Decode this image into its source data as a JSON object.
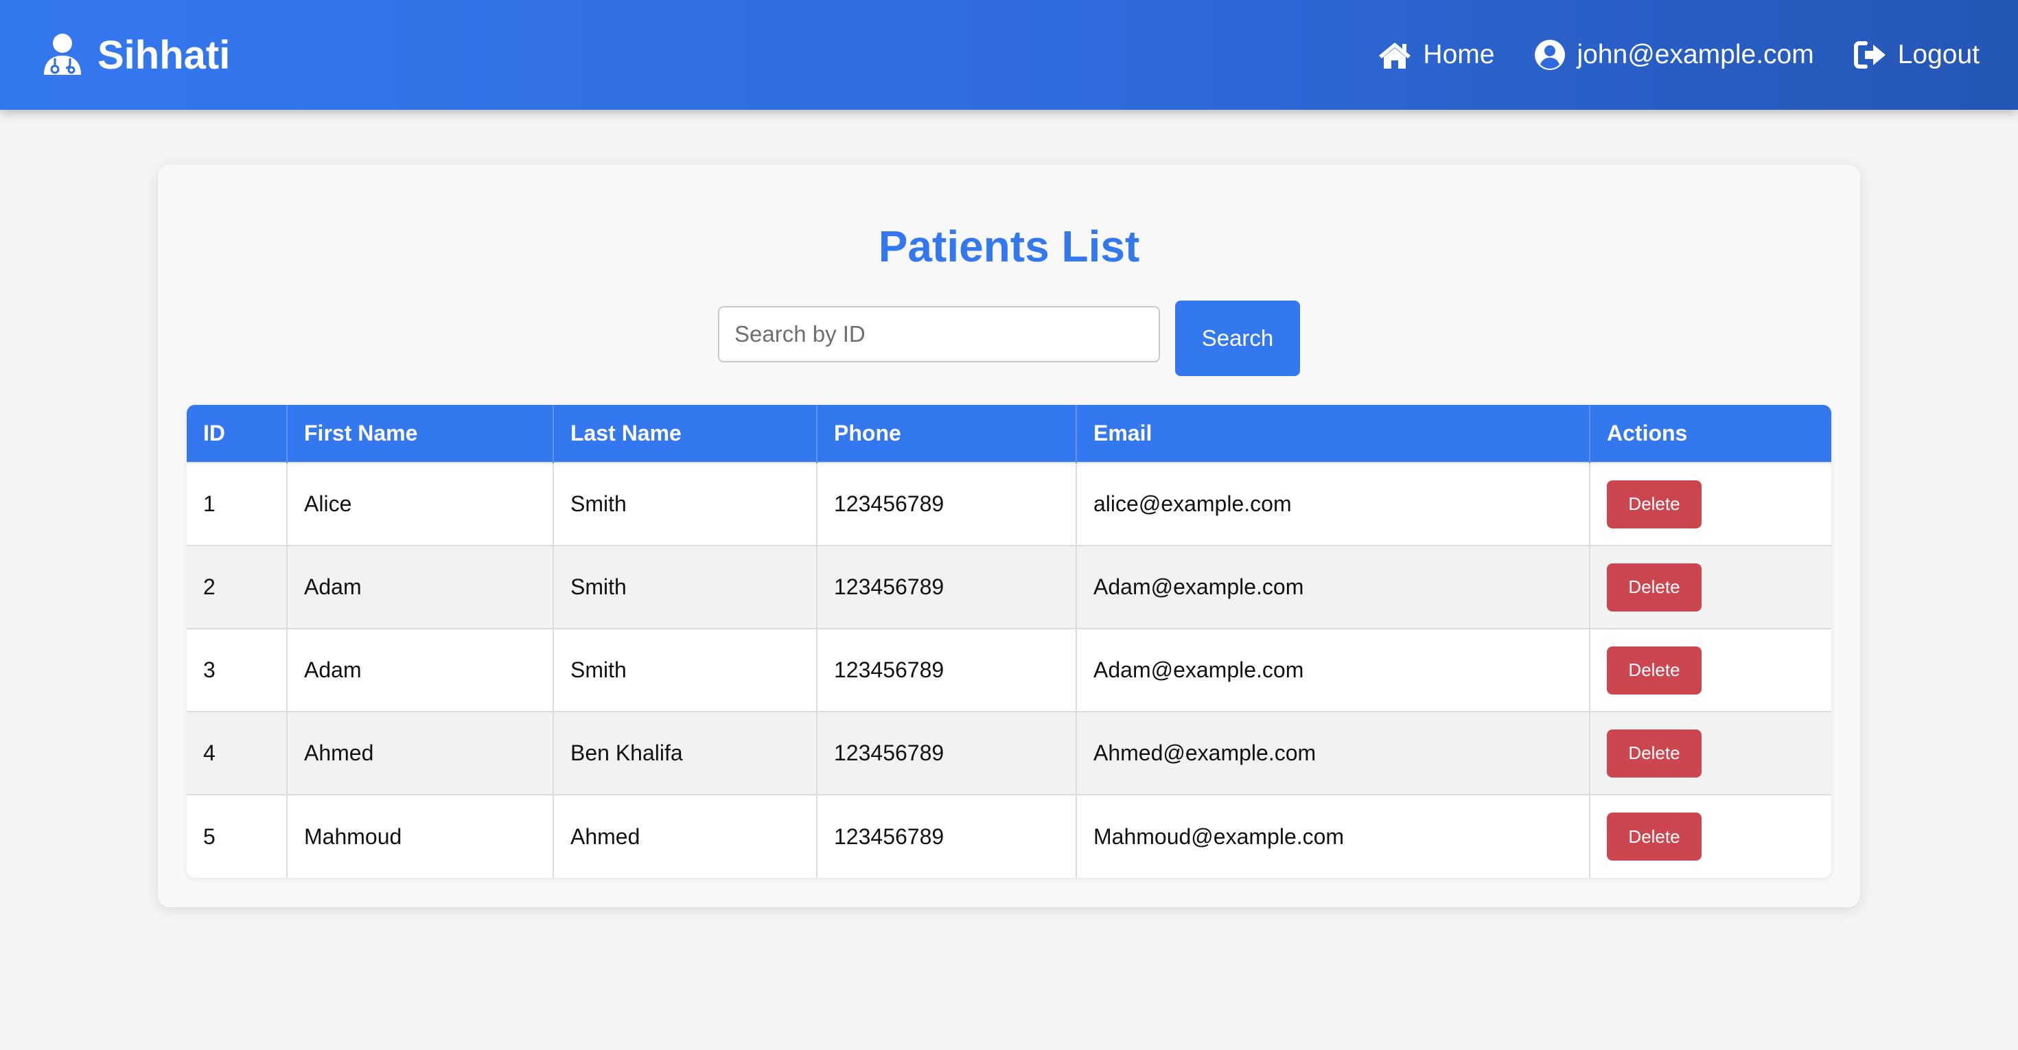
{
  "navbar": {
    "brand": "Sihhati",
    "home_label": "Home",
    "user_label": "john@example.com",
    "logout_label": "Logout",
    "brand_icon": "doctor-icon",
    "home_icon": "home-icon",
    "user_icon": "user-circle-icon",
    "logout_icon": "logout-icon"
  },
  "page": {
    "title": "Patients List"
  },
  "search": {
    "placeholder": "Search by ID",
    "value": "",
    "button_label": "Search"
  },
  "table": {
    "headers": [
      "ID",
      "First Name",
      "Last Name",
      "Phone",
      "Email",
      "Actions"
    ],
    "rows": [
      {
        "id": "1",
        "first_name": "Alice",
        "last_name": "Smith",
        "phone": "123456789",
        "email": "alice@example.com",
        "action": "Delete"
      },
      {
        "id": "2",
        "first_name": "Adam",
        "last_name": "Smith",
        "phone": "123456789",
        "email": "Adam@example.com",
        "action": "Delete"
      },
      {
        "id": "3",
        "first_name": "Adam",
        "last_name": "Smith",
        "phone": "123456789",
        "email": "Adam@example.com",
        "action": "Delete"
      },
      {
        "id": "4",
        "first_name": "Ahmed",
        "last_name": "Ben Khalifa",
        "phone": "123456789",
        "email": "Ahmed@example.com",
        "action": "Delete"
      },
      {
        "id": "5",
        "first_name": "Mahmoud",
        "last_name": "Ahmed",
        "phone": "123456789",
        "email": "Mahmoud@example.com",
        "action": "Delete"
      }
    ]
  },
  "colors": {
    "primary": "#3478f0",
    "navbar_end": "#2456b5",
    "danger": "#cc4650",
    "background": "#f4f4f4"
  }
}
